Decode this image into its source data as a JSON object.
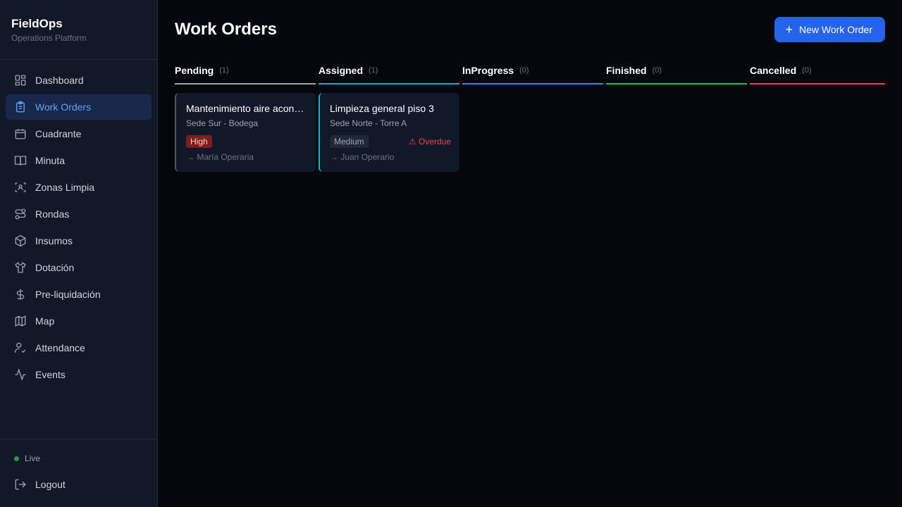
{
  "brand": {
    "title": "FieldOps",
    "subtitle": "Operations Platform"
  },
  "nav": [
    {
      "label": "Dashboard",
      "icon": "dashboard-icon"
    },
    {
      "label": "Work Orders",
      "icon": "clipboard-icon",
      "active": true
    },
    {
      "label": "Cuadrante",
      "icon": "calendar-icon"
    },
    {
      "label": "Minuta",
      "icon": "book-icon"
    },
    {
      "label": "Zonas Limpia",
      "icon": "scan-icon"
    },
    {
      "label": "Rondas",
      "icon": "route-icon"
    },
    {
      "label": "Insumos",
      "icon": "box-icon"
    },
    {
      "label": "Dotación",
      "icon": "shirt-icon"
    },
    {
      "label": "Pre-liquidación",
      "icon": "dollar-icon"
    },
    {
      "label": "Map",
      "icon": "map-icon"
    },
    {
      "label": "Attendance",
      "icon": "user-check-icon"
    },
    {
      "label": "Events",
      "icon": "activity-icon"
    }
  ],
  "footer": {
    "status": "Live",
    "logout": "Logout"
  },
  "header": {
    "title": "Work Orders",
    "new_button": "New Work Order"
  },
  "colors": {
    "accent": "#2563eb",
    "pending": "#9ca3af",
    "assigned": "#06b6d4",
    "inprogress": "#3b82f6",
    "finished": "#22c55e",
    "cancelled": "#ef4444"
  },
  "columns": [
    {
      "title": "Pending",
      "count": "(1)",
      "cards": [
        {
          "title": "Mantenimiento aire acondicionado",
          "location": "Sede Sur - Bodega",
          "priority": "High",
          "overdue": "",
          "assignee": "→ María Operaria"
        }
      ]
    },
    {
      "title": "Assigned",
      "count": "(1)",
      "cards": [
        {
          "title": "Limpieza general piso 3",
          "location": "Sede Norte - Torre A",
          "priority": "Medium",
          "overdue": "⚠ Overdue",
          "assignee": "→ Juan Operario"
        }
      ]
    },
    {
      "title": "InProgress",
      "count": "(0)",
      "cards": []
    },
    {
      "title": "Finished",
      "count": "(0)",
      "cards": []
    },
    {
      "title": "Cancelled",
      "count": "(0)",
      "cards": []
    }
  ]
}
